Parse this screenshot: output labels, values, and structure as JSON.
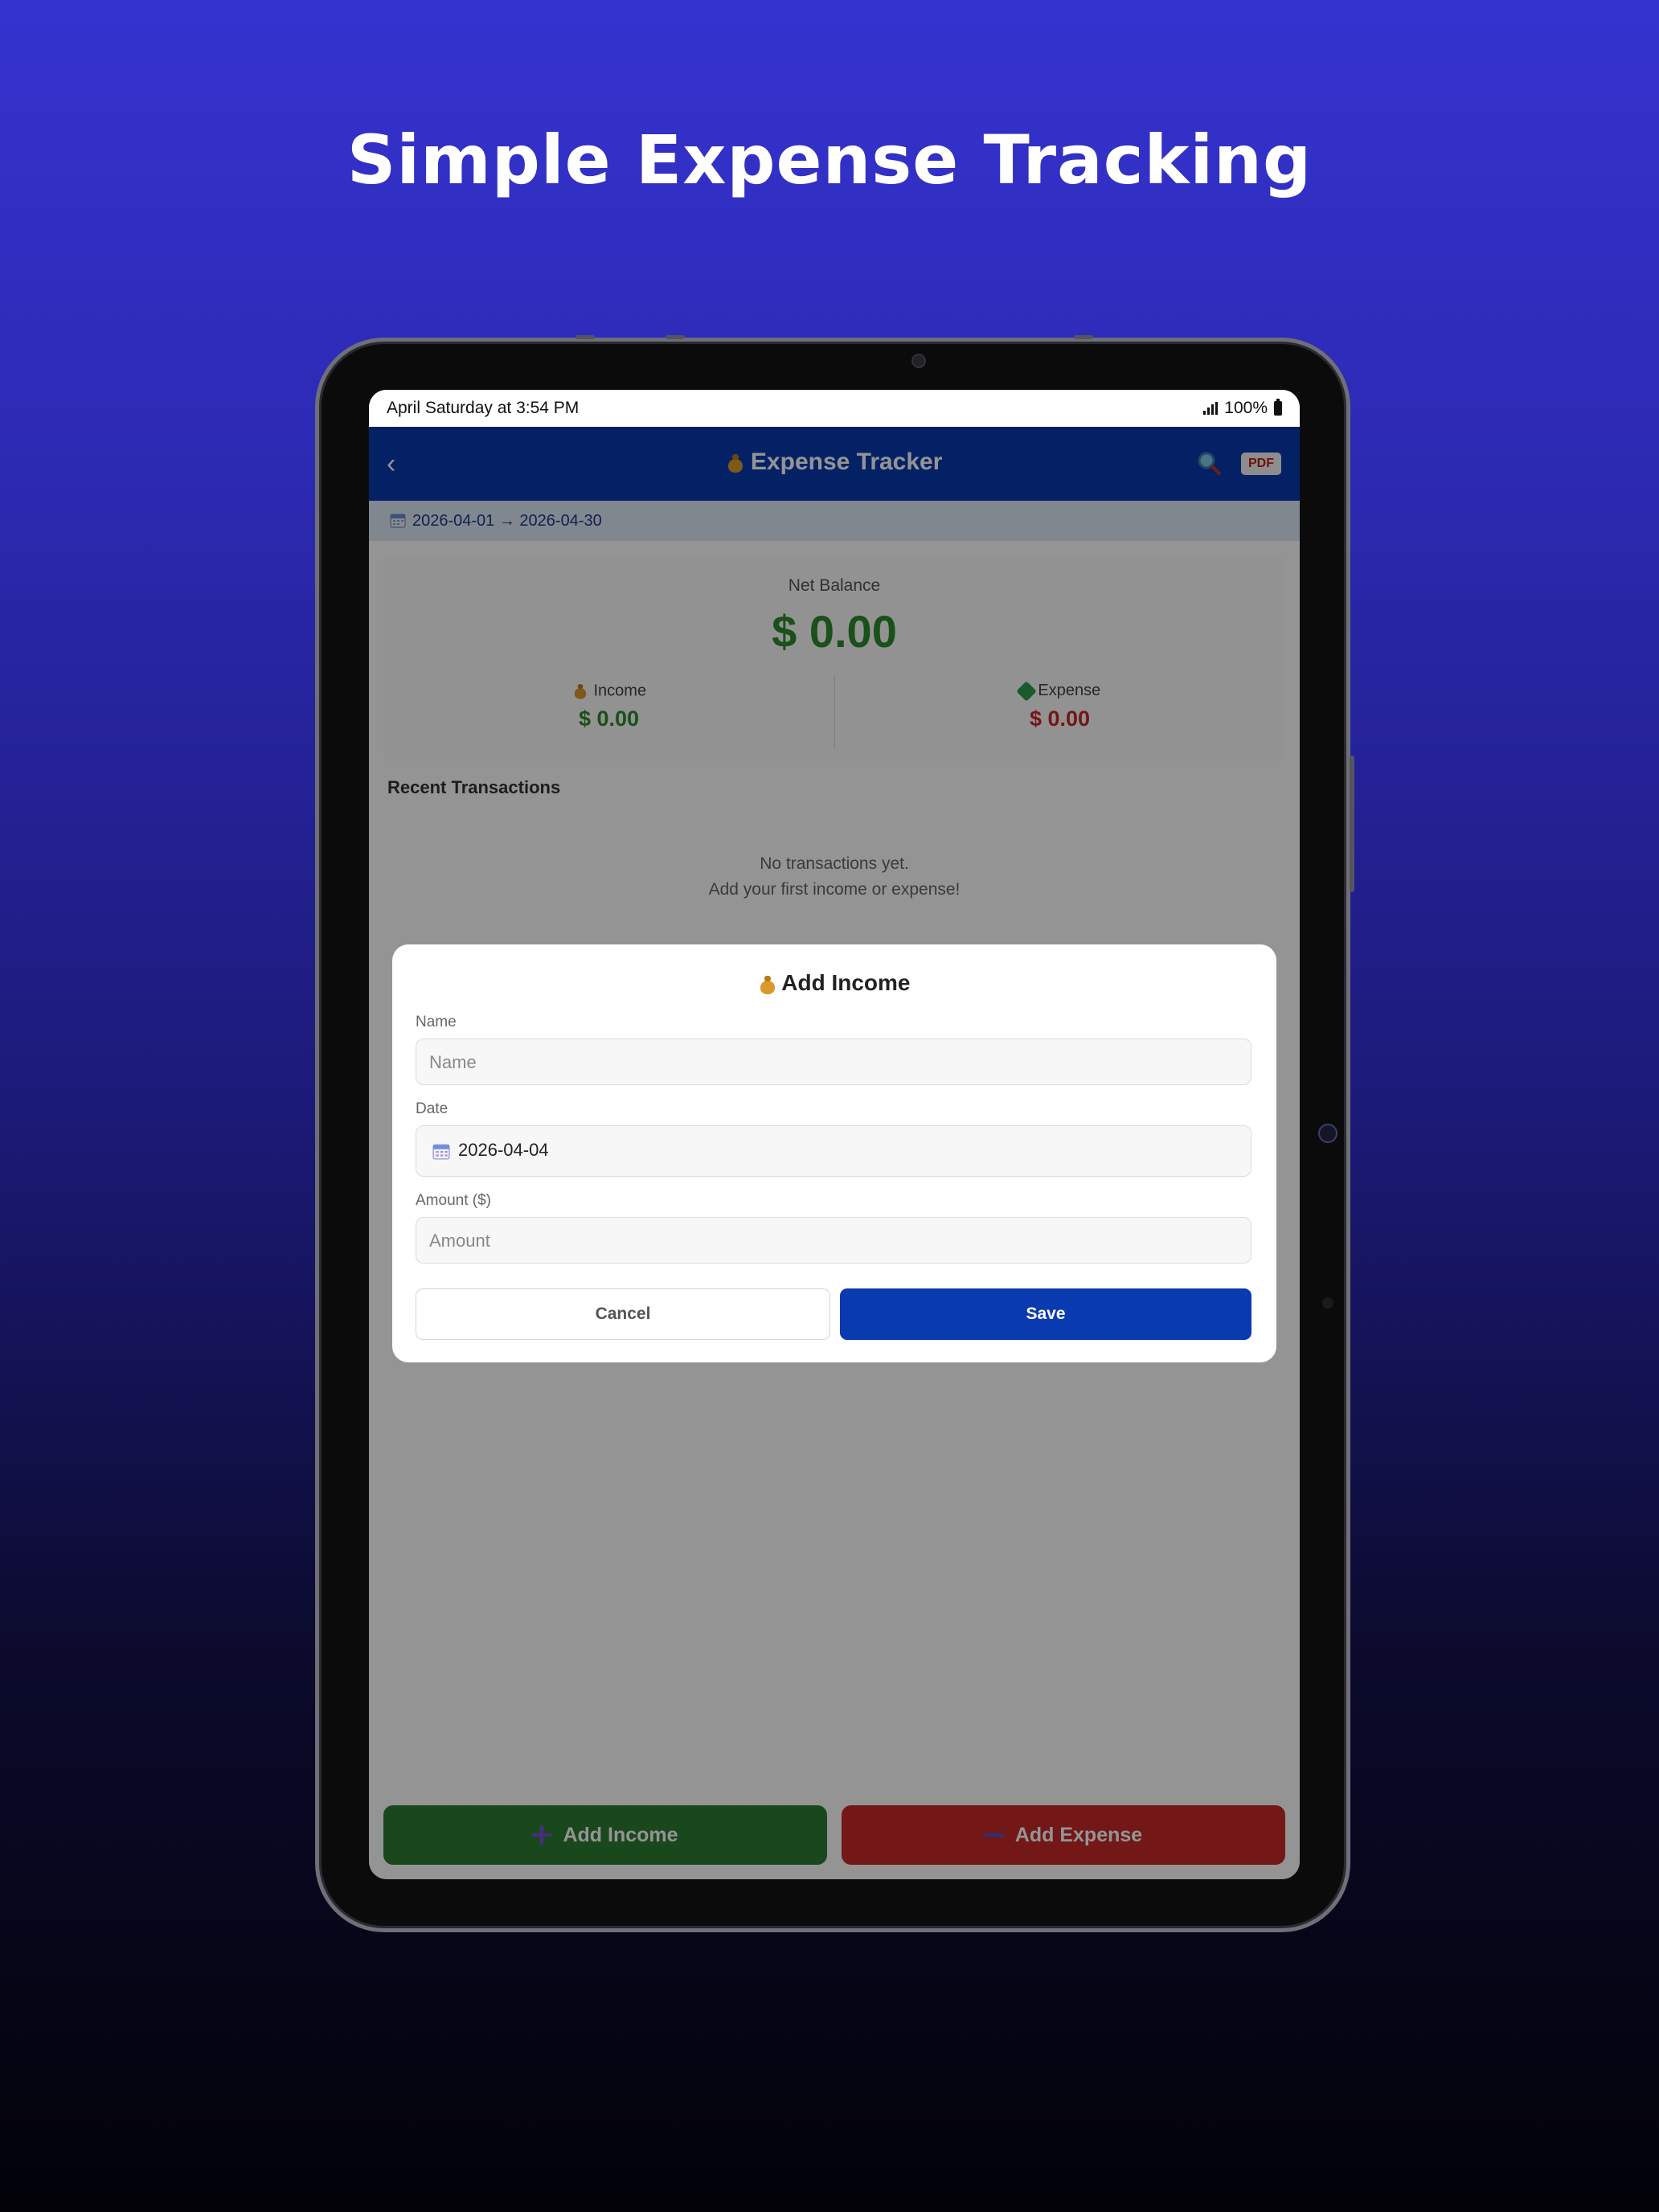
{
  "headline": "Simple Expense Tracking",
  "status_bar": {
    "time": "April Saturday at 3:54 PM",
    "battery": "100%"
  },
  "app_bar": {
    "title": "Expense Tracker",
    "pdf_label": "PDF"
  },
  "date_range": "2026-04-01 → 2026-04-30",
  "summary": {
    "net_label": "Net Balance",
    "net_value": "$ 0.00",
    "income_label": "Income",
    "income_value": "$ 0.00",
    "expense_label": "Expense",
    "expense_value": "$ 0.00"
  },
  "recent": {
    "title": "Recent Transactions",
    "empty_line1": "No transactions yet.",
    "empty_line2": "Add your first income or expense!"
  },
  "dialog": {
    "title": "Add Income",
    "name_label": "Name",
    "name_placeholder": "Name",
    "date_label": "Date",
    "date_value": "2026-04-04",
    "amount_label": "Amount ($)",
    "amount_placeholder": "Amount",
    "cancel_label": "Cancel",
    "save_label": "Save"
  },
  "bottom_buttons": {
    "income_label": "Add Income",
    "expense_label": "Add Expense"
  },
  "colors": {
    "primary": "#0a3ab0",
    "income": "#2e7d32",
    "expense": "#c62828",
    "positive_text": "#2e8b2e"
  },
  "icons": [
    "back-icon",
    "money-bag-icon",
    "search-icon",
    "pdf-icon",
    "calendar-icon",
    "money-icon",
    "plus-icon",
    "minus-icon",
    "signal-icon",
    "battery-icon"
  ]
}
